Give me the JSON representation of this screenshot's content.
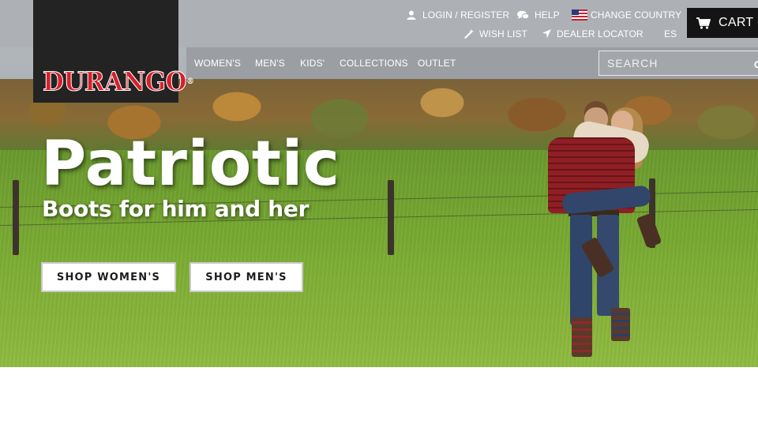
{
  "brand": {
    "name": "DURANGO",
    "registered": "®"
  },
  "utility": {
    "login_register": "LOGIN / REGISTER",
    "help": "HELP",
    "change_country": "CHANGE COUNTRY",
    "wish_list": "WISH LIST",
    "dealer_locator": "DEALER LOCATOR",
    "language": "ES"
  },
  "cart": {
    "label": "CART ("
  },
  "nav": {
    "items": [
      {
        "label": "WOMEN'S"
      },
      {
        "label": "MEN'S"
      },
      {
        "label": "KIDS'"
      },
      {
        "label": "COLLECTIONS"
      },
      {
        "label": "OUTLET"
      }
    ]
  },
  "search": {
    "placeholder": "SEARCH"
  },
  "hero": {
    "title": "Patriotic",
    "subtitle": "Boots for him and her",
    "buttons": [
      {
        "label": "SHOP WOMEN'S"
      },
      {
        "label": "SHOP MEN'S"
      }
    ]
  },
  "icons": {
    "login": "user-icon",
    "help": "chat-bubbles-icon",
    "country": "us-flag-icon",
    "wish_list": "magic-wand-icon",
    "dealer": "location-arrow-icon",
    "cart": "shopping-cart-icon",
    "search": "search-icon"
  },
  "colors": {
    "header_bg": "#adb0b4",
    "nav_bg": "#9b9fa4",
    "logo_bg": "#232323",
    "logo_red": "#d6202b",
    "cart_bg": "#141414"
  }
}
